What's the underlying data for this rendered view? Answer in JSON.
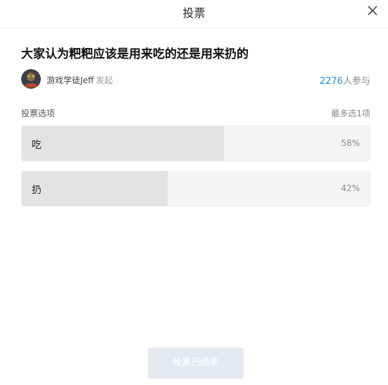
{
  "header": {
    "title": "投票"
  },
  "poll": {
    "question": "大家认为粑粑应该是用来吃的还是用来扔的",
    "author": {
      "name": "游戏学徒Jeff",
      "suffix": "发起"
    },
    "participants": {
      "count": "2276",
      "unit": "人参与"
    },
    "options_label": "投票选项",
    "options_limit": "最多选1项",
    "options": [
      {
        "label": "吃",
        "percent_text": "58%",
        "percent": 58
      },
      {
        "label": "扔",
        "percent_text": "42%",
        "percent": 42
      }
    ]
  },
  "footer": {
    "end_button_label": "投票已结束"
  },
  "colors": {
    "accent": "#1f8fd6",
    "fill": "#e3e3e5",
    "track": "#f4f5f7"
  }
}
